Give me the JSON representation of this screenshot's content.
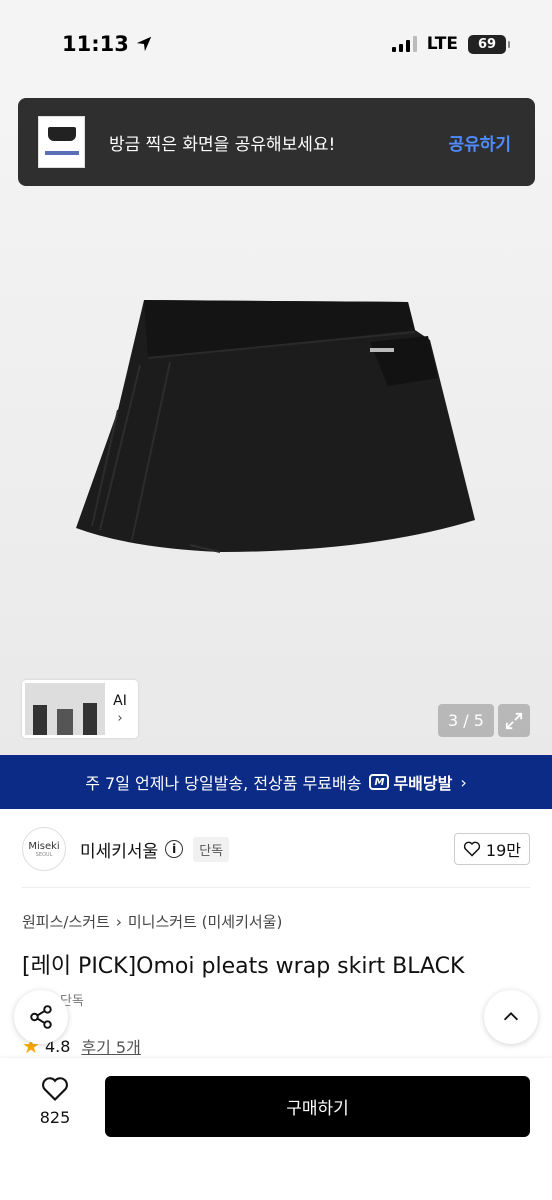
{
  "status_bar": {
    "time": "11:13",
    "network": "LTE",
    "battery": "69"
  },
  "share_toast": {
    "message": "방금 찍은 화면을 공유해보세요!",
    "action": "공유하기"
  },
  "gallery": {
    "ai_label": "AI",
    "page_counter": "3 / 5"
  },
  "shipping_banner": {
    "text": "주 7일 언제나 당일발송, 전상품 무료배송",
    "badge_letter": "M",
    "badge": "무배당발",
    "chevron": "›"
  },
  "brand": {
    "logo_text": "Miseki",
    "logo_subtext": "SEOUL",
    "name": "미세키서울",
    "badge": "단독",
    "likes": "19만"
  },
  "product": {
    "breadcrumb": [
      "원피스/스커트",
      "미니스커트 (미세키서울)"
    ],
    "breadcrumb_separator": "›",
    "title": "[레이 PICK]Omoi pleats wrap skirt BLACK",
    "sub_badge": "단독",
    "rating": "4.8",
    "reviews": "후기 5개"
  },
  "bottom_bar": {
    "wish_count": "825",
    "buy_label": "구매하기"
  },
  "colors": {
    "banner_bg": "#0b2b87",
    "toast_bg": "#2f2f2f",
    "toast_action": "#4f8cff",
    "star": "#f7a800",
    "buy_bg": "#000000"
  }
}
